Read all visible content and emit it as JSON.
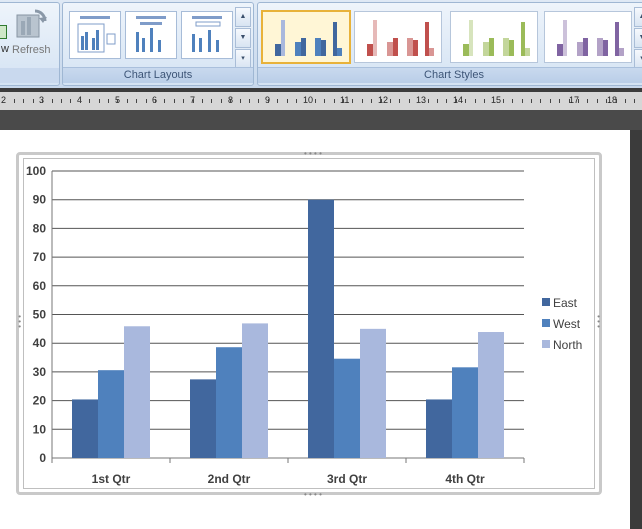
{
  "ribbon": {
    "data_group": {
      "view_label_fragment": "w",
      "refresh_label": "Refresh"
    },
    "layouts_group": {
      "label": "Chart Layouts"
    },
    "styles_group": {
      "label": "Chart Styles"
    }
  },
  "ruler": {
    "numbers": [
      "2",
      "3",
      "4",
      "5",
      "6",
      "7",
      "8",
      "9",
      "10",
      "11",
      "12",
      "13",
      "14",
      "15",
      "17",
      "18"
    ]
  },
  "colors": {
    "east": "#41679e",
    "west": "#4f81bd",
    "north": "#a9b8dd",
    "gridline": "#555555",
    "selected_style": "#e8b23a"
  },
  "chart_data": {
    "type": "bar",
    "categories": [
      "1st Qtr",
      "2nd Qtr",
      "3rd Qtr",
      "4th Qtr"
    ],
    "series": [
      {
        "name": "East",
        "values": [
          20.4,
          27.4,
          90,
          20.4
        ]
      },
      {
        "name": "West",
        "values": [
          30.6,
          38.6,
          34.6,
          31.6
        ]
      },
      {
        "name": "North",
        "values": [
          45.9,
          46.9,
          45,
          43.9
        ]
      }
    ],
    "ylim": [
      0,
      100
    ],
    "yticks": [
      "0",
      "10",
      "20",
      "30",
      "40",
      "50",
      "60",
      "70",
      "80",
      "90",
      "100"
    ],
    "grid": true,
    "legend": "right"
  }
}
